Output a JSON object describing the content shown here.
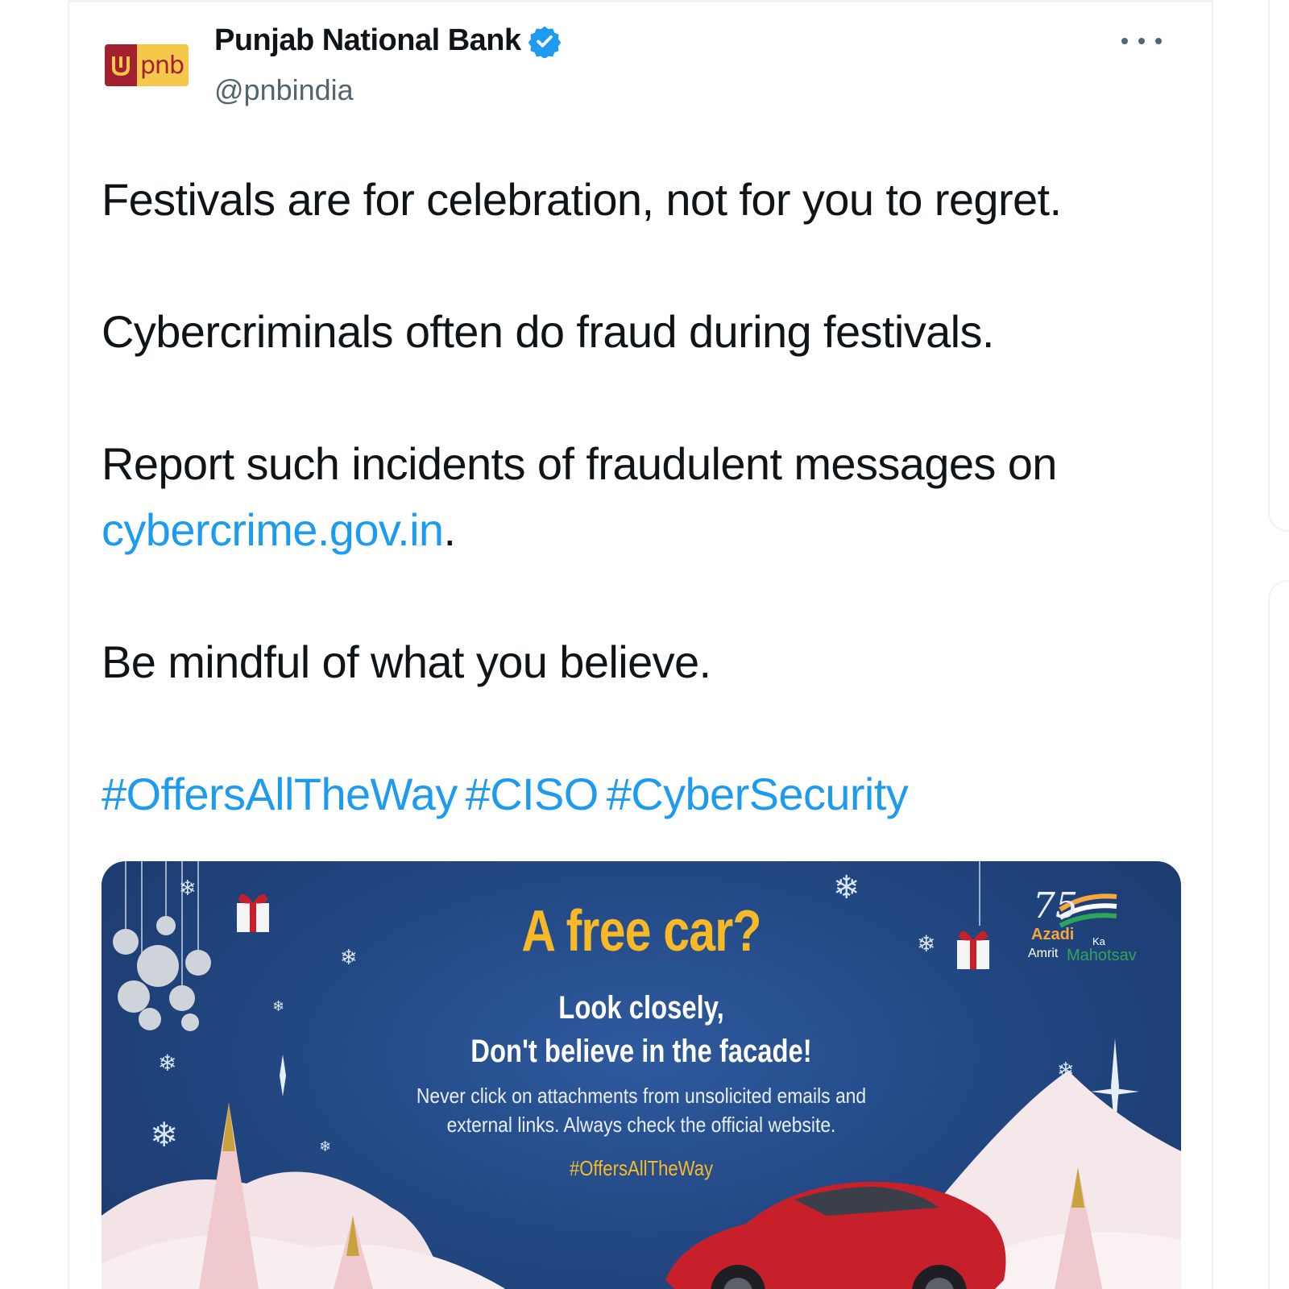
{
  "tweet": {
    "author": {
      "display_name": "Punjab National Bank",
      "handle": "@pnbindia",
      "avatar_text": "pnb",
      "verified_icon": "verified-badge-icon"
    },
    "more_icon": "more-dots-icon",
    "paragraphs": {
      "p1": "Festivals are for celebration, not for you to regret.",
      "p2": "Cybercriminals often do fraud during festivals.",
      "p3_text": "Report such incidents of fraudulent messages on",
      "p3_link": "cybercrime.gov.in",
      "p3_end": ".",
      "p4": "Be mindful of what you believe."
    },
    "hashtags": [
      "#OffersAllTheWay",
      "#CISO",
      "#CyberSecurity"
    ]
  },
  "media": {
    "headline": "A free car?",
    "sub_line1": "Look closely,",
    "sub_line2": "Don't believe in the facade!",
    "body_line1": "Never click on attachments from unsolicited emails and",
    "body_line2": "external links. Always check the official website.",
    "tag": "#OffersAllTheWay",
    "logo": {
      "number": "75",
      "word1": "Azadi",
      "word2": "Ka",
      "word3": "Amrit",
      "word4": "Mahotsav"
    }
  },
  "colors": {
    "link": "#1d9bf0",
    "text": "#0f1419",
    "secondary": "#536471",
    "headline": "#f7b928",
    "media_bg": "#234a86",
    "brand_red": "#a3212e",
    "brand_yellow": "#f5c84c"
  }
}
